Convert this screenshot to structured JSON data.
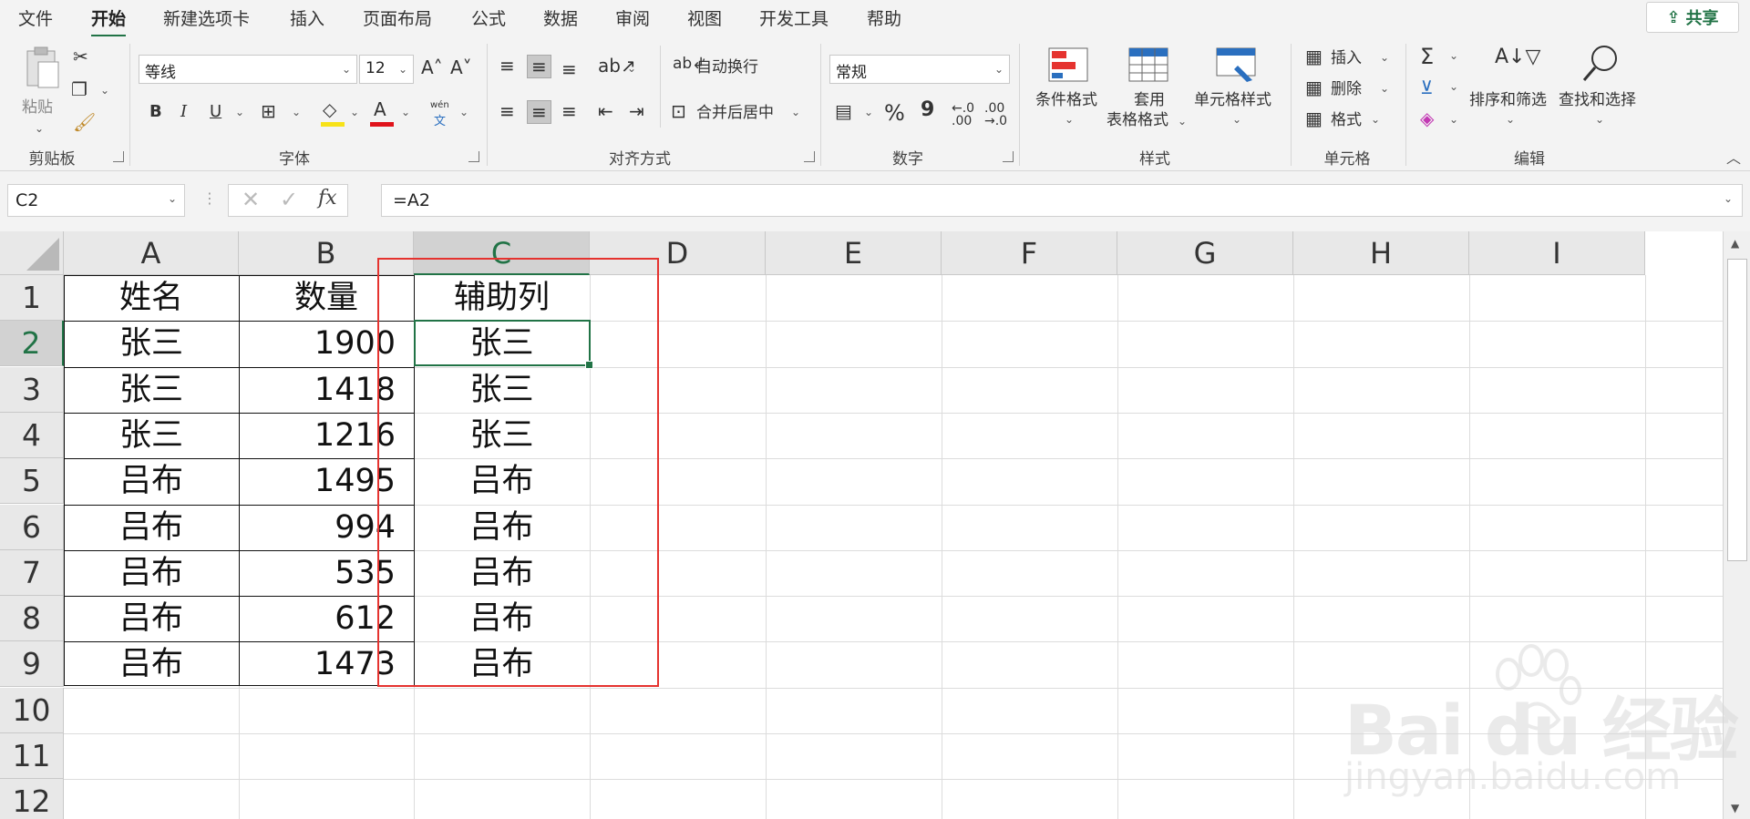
{
  "tabs": [
    "文件",
    "开始",
    "新建选项卡",
    "插入",
    "页面布局",
    "公式",
    "数据",
    "审阅",
    "视图",
    "开发工具",
    "帮助"
  ],
  "active_tab": "开始",
  "share": "共享",
  "ribbon": {
    "clipboard": {
      "group": "剪贴板",
      "paste": "粘贴"
    },
    "font": {
      "group": "字体",
      "name": "等线",
      "size": "12",
      "bold": "B",
      "italic": "I",
      "underline": "U",
      "pinyin_top": "wén",
      "pinyin_bottom": "文"
    },
    "align": {
      "group": "对齐方式",
      "wrap": "自动换行",
      "merge": "合并后居中"
    },
    "number": {
      "group": "数字",
      "format": "常规",
      "percent": "%",
      "comma": "9"
    },
    "styles": {
      "group": "样式",
      "conditional": "条件格式",
      "table1": "套用",
      "table2": "表格格式",
      "cell_style": "单元格样式"
    },
    "cells": {
      "group": "单元格",
      "insert": "插入",
      "delete": "删除",
      "format": "格式"
    },
    "edit": {
      "group": "编辑",
      "sort": "排序和筛选",
      "find": "查找和选择"
    }
  },
  "formula_bar": {
    "name_box": "C2",
    "formula": "=A2"
  },
  "columns": [
    "A",
    "B",
    "C",
    "D",
    "E",
    "F",
    "G",
    "H",
    "I"
  ],
  "rows": [
    "1",
    "2",
    "3",
    "4",
    "5",
    "6",
    "7",
    "8",
    "9",
    "10",
    "11",
    "12"
  ],
  "cells": [
    [
      "姓名",
      "数量",
      "辅助列"
    ],
    [
      "张三",
      "1900",
      "张三"
    ],
    [
      "张三",
      "1418",
      "张三"
    ],
    [
      "张三",
      "1216",
      "张三"
    ],
    [
      "吕布",
      "1495",
      "吕布"
    ],
    [
      "吕布",
      "994",
      "吕布"
    ],
    [
      "吕布",
      "535",
      "吕布"
    ],
    [
      "吕布",
      "612",
      "吕布"
    ],
    [
      "吕布",
      "1473",
      "吕布"
    ]
  ],
  "watermark": {
    "brand": "Bai  du 经验",
    "url": "jingyan.baidu.com"
  },
  "colors": {
    "accent": "#217346",
    "highlight": "#e5332f"
  }
}
